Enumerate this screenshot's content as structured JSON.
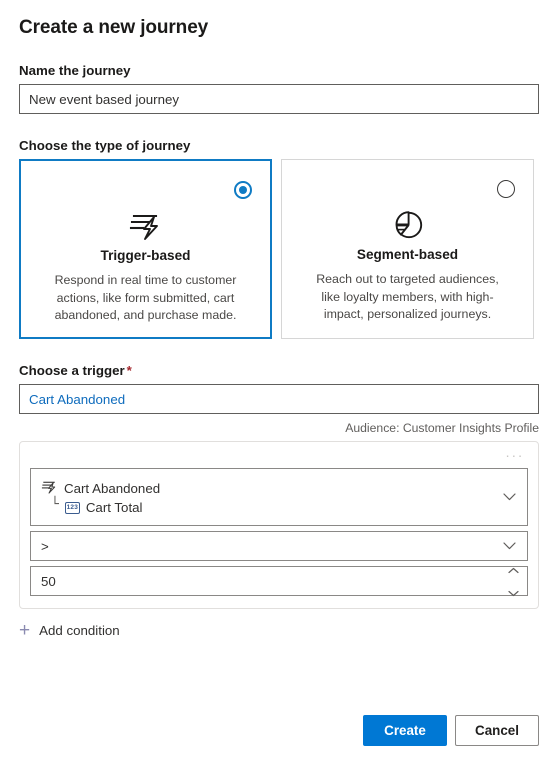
{
  "dialog": {
    "title": "Create a new journey"
  },
  "name_field": {
    "label": "Name the journey",
    "value": "New event based journey",
    "placeholder": "New event based journey"
  },
  "journey_type": {
    "label": "Choose the type of journey",
    "options": [
      {
        "id": "trigger-based",
        "title": "Trigger-based",
        "description": "Respond in real time to customer actions, like form submitted, cart abandoned, and purchase made.",
        "icon": "lightning-trigger-icon",
        "selected": true
      },
      {
        "id": "segment-based",
        "title": "Segment-based",
        "description": "Reach out to targeted audiences, like loyalty members, with high-impact, personalized journeys.",
        "icon": "pie-chart-segment-icon",
        "selected": false
      }
    ]
  },
  "trigger_field": {
    "label": "Choose a trigger",
    "required_marker": "*",
    "value": "Cart Abandoned",
    "placeholder": "Choose a trigger",
    "audience_note": "Audience: Customer Insights Profile"
  },
  "condition_panel": {
    "overflow_menu": "···",
    "attribute": {
      "trigger_name": "Cart Abandoned",
      "trigger_icon": "lightning-trigger-icon",
      "branch_glyph": "└",
      "attribute_name": "Cart Total",
      "attribute_type_icon": "number-type-icon",
      "attribute_type_label": "123"
    },
    "operator": {
      "value": ">",
      "chevron_icon": "chevron-down-icon"
    },
    "value": {
      "value": "50",
      "spinner_up_icon": "chevron-up-icon",
      "spinner_down_icon": "chevron-down-icon"
    }
  },
  "add_condition": {
    "icon": "plus-icon",
    "label": "Add condition"
  },
  "footer": {
    "create_label": "Create",
    "cancel_label": "Cancel"
  },
  "colors": {
    "accent": "#0078d4",
    "selected_border": "#0f7bc4",
    "link_text": "#0f6cbd",
    "required_star": "#a4262c"
  }
}
